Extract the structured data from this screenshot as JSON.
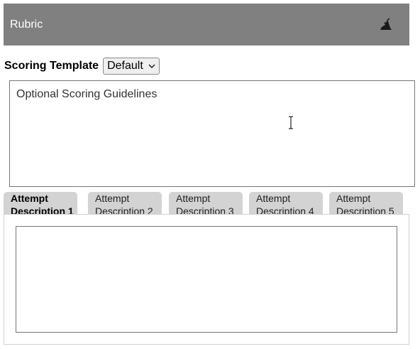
{
  "header": {
    "title": "Rubric",
    "icon": "wizard-hat-icon"
  },
  "scoring": {
    "label": "Scoring Template",
    "selected": "Default"
  },
  "guidelines": {
    "placeholder": "Optional Scoring Guidelines"
  },
  "tabs": [
    {
      "line1": "Attempt",
      "line2": "Description 1",
      "active": true
    },
    {
      "line1": "Attempt",
      "line2": "Description 2",
      "active": false
    },
    {
      "line1": "Attempt",
      "line2": "Description 3",
      "active": false
    },
    {
      "line1": "Attempt",
      "line2": "Description 4",
      "active": false
    },
    {
      "line1": "Attempt",
      "line2": "Description 5",
      "active": false
    }
  ],
  "description": {
    "value": ""
  }
}
